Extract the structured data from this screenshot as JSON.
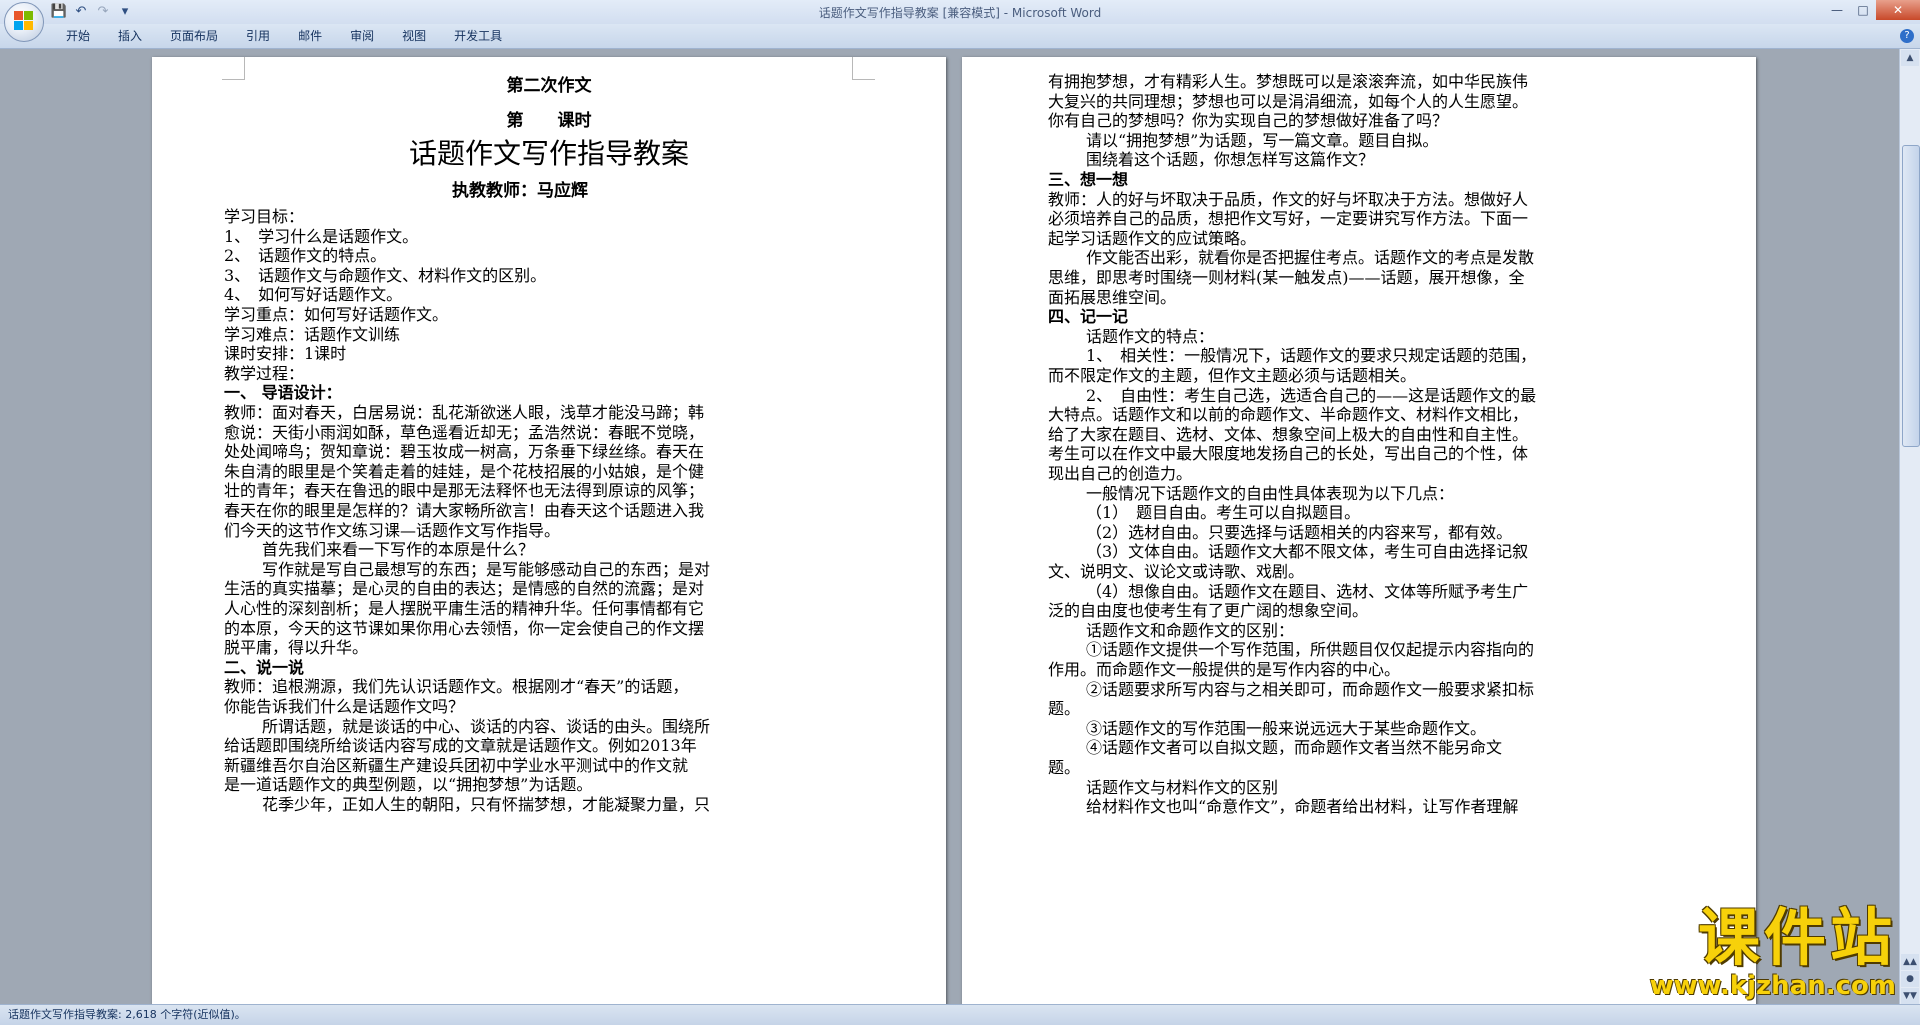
{
  "window": {
    "title": "话题作文写作指导教案 [兼容模式] - Microsoft Word"
  },
  "quick_access": {
    "save": "save-icon",
    "undo": "undo-icon",
    "redo": "redo-icon",
    "customize": "dropdown-icon"
  },
  "ribbon": {
    "tabs": [
      "开始",
      "插入",
      "页面布局",
      "引用",
      "邮件",
      "审阅",
      "视图",
      "开发工具"
    ]
  },
  "left_page": {
    "lines": [
      "第二次作文",
      "第　　课时",
      "话题作文写作指导教案",
      "执教教师：马应辉",
      "学习目标：",
      "1、　学习什么是话题作文。",
      "2、　话题作文的特点。",
      "3、　话题作文与命题作文、材料作文的区别。",
      "4、　如何写好话题作文。",
      "学习重点：如何写好话题作文。",
      "学习难点：话题作文训练",
      "课时安排：1课时",
      "教学过程：",
      "一、 导语设计：",
      "教师：面对春天，白居易说：乱花渐欲迷人眼，浅草才能没马蹄；韩",
      "愈说：天街小雨润如酥，草色遥看近却无；孟浩然说：春眠不觉晓，",
      "处处闻啼鸟；贺知章说：碧玉妆成一树高，万条垂下绿丝绦。春天在",
      "朱自清的眼里是个笑着走着的娃娃，是个花枝招展的小姑娘，是个健",
      "壮的青年；春天在鲁迅的眼中是那无法释怀也无法得到原谅的风筝；",
      "春天在你的眼里是怎样的？请大家畅所欲言！由春天这个话题进入我",
      "们今天的这节作文练习课—话题作文写作指导。",
      "首先我们来看一下写作的本原是什么？",
      "写作就是写自己最想写的东西；是写能够感动自己的东西；是对",
      "生活的真实描摹；是心灵的自由的表达；是情感的自然的流露；是对",
      "人心性的深刻剖析；是人摆脱平庸生活的精神升华。任何事情都有它",
      "的本原，今天的这节课如果你用心去领悟，你一定会使自己的作文摆",
      "脱平庸，得以升华。",
      "二、说一说",
      "教师：追根溯源，我们先认识话题作文。根据刚才“春天”的话题，",
      "你能告诉我们什么是话题作文吗？",
      "所谓话题，就是谈话的中心、谈话的内容、谈话的由头。围绕所",
      "给话题即围绕所给谈话内容写成的文章就是话题作文。例如2013年",
      "新疆维吾尔自治区新疆生产建设兵团初中学业水平测试中的作文就",
      "是一道话题作文的典型例题，以“拥抱梦想”为话题。",
      "花季少年，正如人生的朝阳，只有怀揣梦想，才能凝聚力量，只"
    ]
  },
  "right_page": {
    "lines": [
      "有拥抱梦想，才有精彩人生。梦想既可以是滚滚奔流，如中华民族伟",
      "大复兴的共同理想；梦想也可以是涓涓细流，如每个人的人生愿望。",
      "你有自己的梦想吗？你为实现自己的梦想做好准备了吗？",
      "请以“拥抱梦想”为话题，写一篇文章。题目自拟。",
      "围绕着这个话题，你想怎样写这篇作文？",
      "三、想一想",
      "教师：人的好与坏取决于品质，作文的好与坏取决于方法。想做好人",
      "必须培养自己的品质，想把作文写好，一定要讲究写作方法。下面一",
      "起学习话题作文的应试策略。",
      "作文能否出彩，就看你是否把握住考点。话题作文的考点是发散",
      "思维，即思考时围绕一则材料(某一触发点)——话题，展开想像，全",
      "面拓展思维空间。",
      "四、记一记",
      "话题作文的特点：",
      "1、　相关性：一般情况下，话题作文的要求只规定话题的范围，",
      "而不限定作文的主题，但作文主题必须与话题相关。",
      "2、　自由性：考生自己选，选适合自己的——这是话题作文的最",
      "大特点。话题作文和以前的命题作文、半命题作文、材料作文相比，",
      "给了大家在题目、选材、文体、想象空间上极大的自由性和自主性。",
      "考生可以在作文中最大限度地发扬自己的长处，写出自己的个性，体",
      "现出自己的创造力。",
      "一般情况下话题作文的自由性具体表现为以下几点：",
      "（1）　题目自由。考生可以自拟题目。",
      "（2）选材自由。只要选择与话题相关的内容来写，都有效。",
      "（3）文体自由。话题作文大都不限文体，考生可自由选择记叙",
      "文、说明文、议论文或诗歌、戏剧。",
      "（4）想像自由。话题作文在题目、选材、文体等所赋予考生广",
      "泛的自由度也使考生有了更广阔的想象空间。",
      "话题作文和命题作文的区别：",
      "①话题作文提供一个写作范围，所供题目仅仅起提示内容指向的",
      "作用。而命题作文一般提供的是写作内容的中心。",
      "②话题要求所写内容与之相关即可，而命题作文一般要求紧扣标",
      "题。",
      "③话题作文的写作范围一般来说远远大于某些命题作文。",
      "④话题作文者可以自拟文题，而命题作文者当然不能另命文",
      "题。",
      "话题作文与材料作文的区别",
      "给材料作文也叫“命意作文”，命题者给出材料，让写作者理解"
    ]
  },
  "status_bar": {
    "text": "话题作文写作指导教案: 2,618 个字符(近似值)。"
  },
  "watermark": {
    "main": "课件站",
    "url": "www.kjzhan.com"
  }
}
